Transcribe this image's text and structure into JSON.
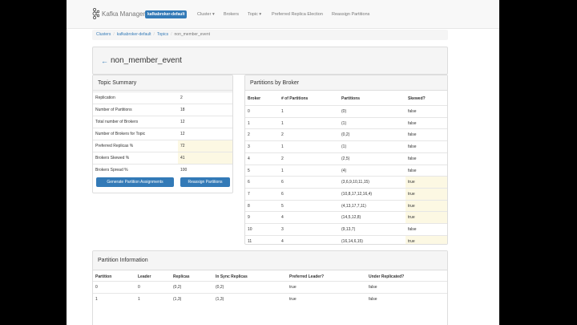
{
  "navbar": {
    "brand": "Kafka Manager",
    "cluster_badge": "kafkabroker-default",
    "items": [
      "Cluster",
      "Brokers",
      "Topic",
      "Preferred Replica Election",
      "Reassign Partitions"
    ]
  },
  "breadcrumb": [
    "Clusters",
    "kafkabroker-default",
    "Topics",
    "non_member_event"
  ],
  "topic": {
    "name": "non_member_event"
  },
  "summary": {
    "heading": "Topic Summary",
    "rows": [
      {
        "label": "Replication",
        "value": "2"
      },
      {
        "label": "Number of Partitions",
        "value": "18"
      },
      {
        "label": "Total number of Brokers",
        "value": "12"
      },
      {
        "label": "Number of Brokers for Topic",
        "value": "12"
      },
      {
        "label": "Preferred Replicas %",
        "value": "72"
      },
      {
        "label": "Brokers Skewed %",
        "value": "41"
      },
      {
        "label": "Brokers Spread %",
        "value": "100"
      }
    ],
    "generate_button": "Generate Partition Assignments",
    "reassign_button": "Reassign Partitions"
  },
  "brokers": {
    "heading": "Partitions by Broker",
    "headers": [
      "Broker",
      "# of Partitions",
      "Partitions",
      "Skewed?"
    ],
    "rows": [
      {
        "broker": "0",
        "count": "1",
        "partitions": "(0)",
        "skewed": "false"
      },
      {
        "broker": "1",
        "count": "1",
        "partitions": "(1)",
        "skewed": "false"
      },
      {
        "broker": "2",
        "count": "2",
        "partitions": "(0,2)",
        "skewed": "false"
      },
      {
        "broker": "3",
        "count": "1",
        "partitions": "(1)",
        "skewed": "false"
      },
      {
        "broker": "4",
        "count": "2",
        "partitions": "(2,5)",
        "skewed": "false"
      },
      {
        "broker": "5",
        "count": "1",
        "partitions": "(4)",
        "skewed": "false"
      },
      {
        "broker": "6",
        "count": "6",
        "partitions": "(3,6,9,10,11,15)",
        "skewed": "true"
      },
      {
        "broker": "7",
        "count": "6",
        "partitions": "(10,8,17,12,16,4)",
        "skewed": "true"
      },
      {
        "broker": "8",
        "count": "5",
        "partitions": "(4,13,17,7,11)",
        "skewed": "true"
      },
      {
        "broker": "9",
        "count": "4",
        "partitions": "(14,5,12,8)",
        "skewed": "true"
      },
      {
        "broker": "10",
        "count": "3",
        "partitions": "(9,13,7)",
        "skewed": "false"
      },
      {
        "broker": "11",
        "count": "4",
        "partitions": "(16,14,6,15)",
        "skewed": "true"
      }
    ]
  },
  "partitions": {
    "heading": "Partition Information",
    "headers": [
      "Partition",
      "Leader",
      "Replicas",
      "In Sync Replicas",
      "Preferred Leader?",
      "Under Replicated?"
    ],
    "rows": [
      {
        "partition": "0",
        "leader": "0",
        "replicas": "(0,2)",
        "isr": "(0,2)",
        "preferred": "true",
        "under": "false"
      },
      {
        "partition": "1",
        "leader": "1",
        "replicas": "(1,3)",
        "isr": "(1,3)",
        "preferred": "true",
        "under": "false"
      }
    ]
  },
  "colors": {
    "primary": "#337ab7",
    "warning_bg": "#fcf8e3"
  }
}
